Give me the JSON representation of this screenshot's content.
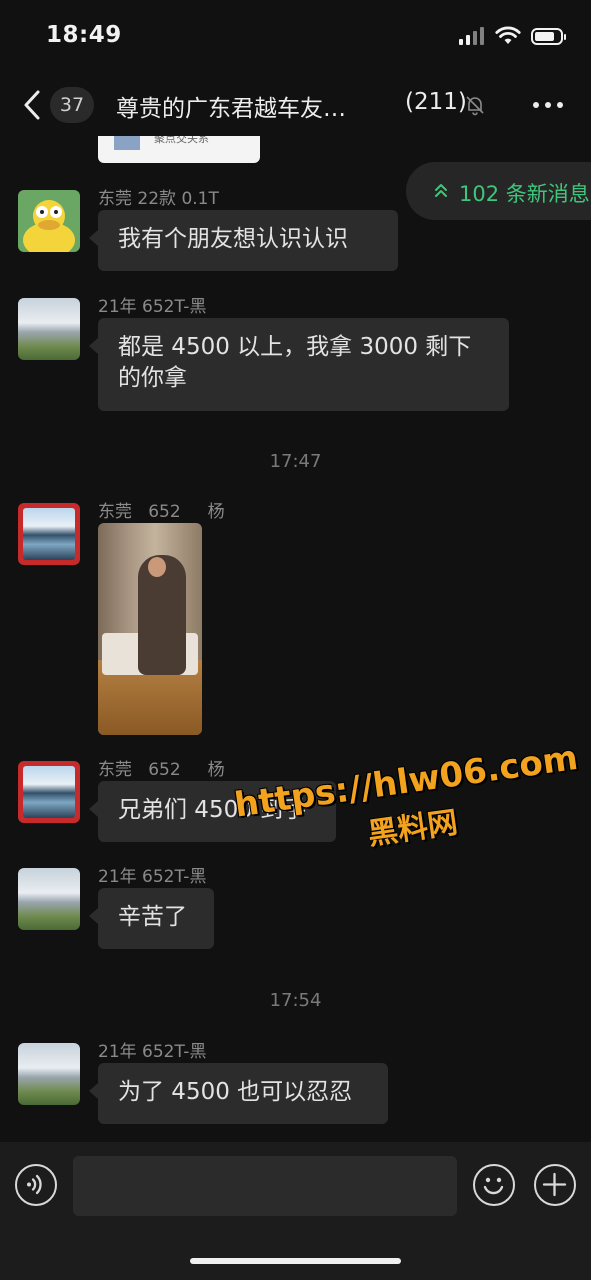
{
  "status_bar": {
    "time": "18:49",
    "battery_level": 0.8
  },
  "nav": {
    "back_label": "",
    "unread_count": "37",
    "title": "尊贵的广东君越车友…",
    "member_count": "(211)",
    "icons": [
      "chevron-left-icon",
      "bell-muted-icon",
      "more-icon"
    ]
  },
  "previous_bubble": {
    "text": "聚点交关系"
  },
  "new_messages": {
    "label": "102 条新消息",
    "color": "#3fc67a"
  },
  "messages": [
    {
      "sender": "东莞 22款 0.1T",
      "text": "我有个朋友想认识认识",
      "avatar": "duck"
    },
    {
      "sender": "21年 652T-黑",
      "text": "都是 4500 以上，我拿 3000 剩下的你拿",
      "avatar": "mountain"
    },
    {
      "sender": "东莞   652     杨",
      "type": "image",
      "avatar": "lake"
    },
    {
      "sender": "东莞   652     杨",
      "text": "兄弟们 4500 到手",
      "avatar": "lake"
    },
    {
      "sender": "21年 652T-黑",
      "text": "辛苦了",
      "avatar": "mountain"
    },
    {
      "sender": "21年 652T-黑",
      "text": "为了 4500 也可以忍忍",
      "avatar": "mountain"
    }
  ],
  "timestamps": [
    "17:47",
    "17:54"
  ],
  "watermark": {
    "url": "https://hlw06.com",
    "name": "黑料网"
  },
  "input_bar": {
    "placeholder": "",
    "value": "",
    "icons": [
      "voice-icon",
      "emoji-icon",
      "plus-icon"
    ]
  },
  "colors": {
    "background": "#111111",
    "bubble": "#2c2c2c",
    "accent": "#3fc67a",
    "watermark": "#f3a21e"
  }
}
